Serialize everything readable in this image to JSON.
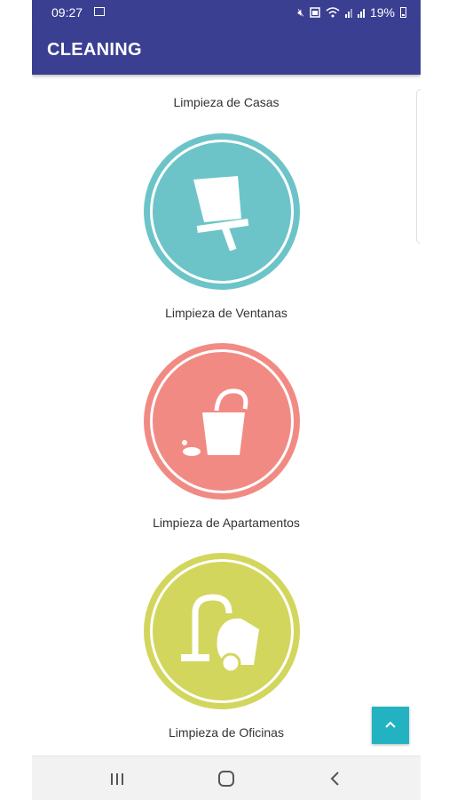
{
  "status_bar": {
    "time": "09:27",
    "battery": "19%"
  },
  "app_bar": {
    "title": "CLEANING",
    "color": "#3a3f92"
  },
  "services": [
    {
      "label": "Limpieza de Casas",
      "color": "#6fc6c9",
      "icon": "house-icon"
    },
    {
      "label": "Limpieza de Ventanas",
      "color": "#6cc4c8",
      "icon": "squeegee-icon"
    },
    {
      "label": "Limpieza de Apartamentos",
      "color": "#f28a84",
      "icon": "bucket-icon"
    },
    {
      "label": "Limpieza de Oficinas",
      "color": "#d2d65c",
      "icon": "vacuum-icon"
    }
  ],
  "fab": {
    "icon": "chevron-up-icon",
    "color": "#22b2c2"
  },
  "nav_bar": {
    "icons": [
      "recents-icon",
      "home-icon",
      "back-icon"
    ]
  }
}
